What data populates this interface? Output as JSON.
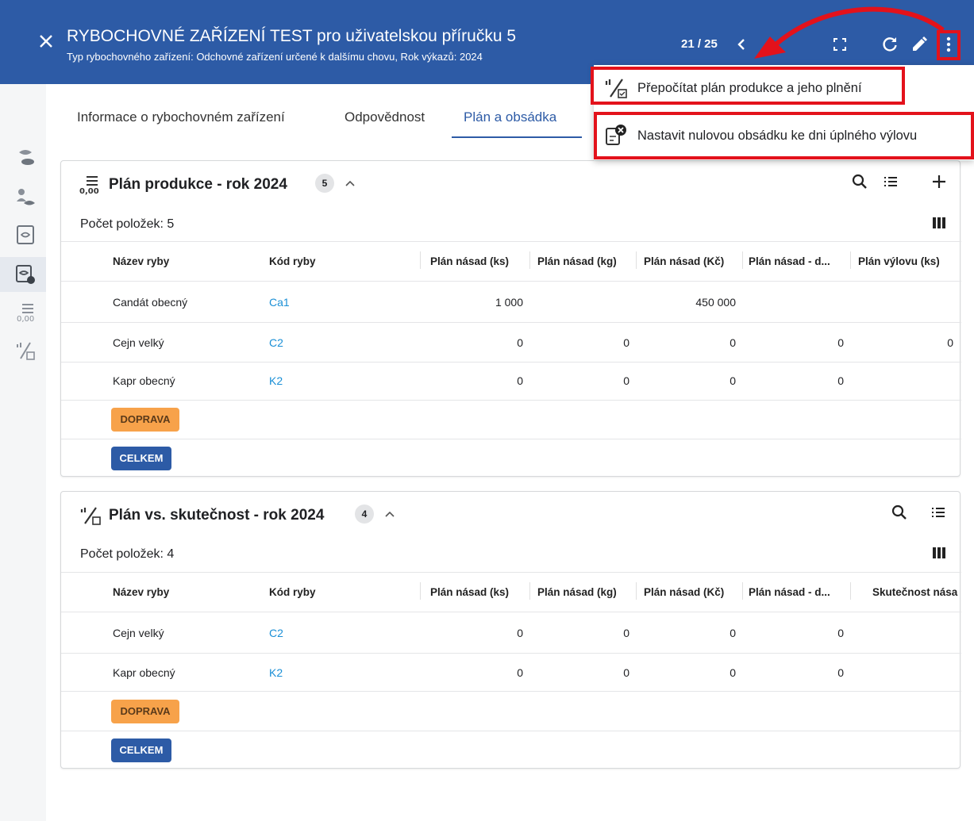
{
  "header": {
    "title": "RYBOCHOVNÉ ZAŘÍZENÍ TEST pro uživatelskou příručku 5",
    "subtitle": "Typ rybochovného zařízení: Odchovné zařízení určené k dalšímu chovu, Rok výkazů: 2024",
    "pager": "21 / 25",
    "icons": [
      "close-icon",
      "chevron-left-icon",
      "fullscreen-icon",
      "refresh-icon",
      "edit-icon",
      "more-vert-icon"
    ],
    "color": "#2d5ba6"
  },
  "menu": {
    "items": [
      {
        "label": "Přepočítat plán produkce a jeho plnění",
        "icon": "recalculate-icon"
      },
      {
        "label": "Nastavit nulovou obsádku ke dni úplného výlovu",
        "icon": "clear-stock-icon"
      }
    ],
    "highlight_color": "#e3121b"
  },
  "tabs": [
    {
      "label": "Informace o rybochovném zařízení",
      "active": false
    },
    {
      "label": "Odpovědnost",
      "active": false
    },
    {
      "label": "Plán a obsádka",
      "active": true
    }
  ],
  "panels": [
    {
      "title": "Plán produkce - rok 2024",
      "badge": "5",
      "count_label": "Počet položek: 5",
      "columns": [
        "Název ryby",
        "Kód ryby",
        "Plán násad (ks)",
        "Plán násad (kg)",
        "Plán násad (Kč)",
        "Plán násad - d...",
        "Plán výlovu (ks)"
      ],
      "rows": [
        [
          "Candát obecný",
          "Ca1",
          "1 000",
          "",
          "450 000",
          "",
          ""
        ],
        [
          "Cejn velký",
          "C2",
          "0",
          "0",
          "0",
          "0",
          "0"
        ],
        [
          "Kapr obecný",
          "K2",
          "0",
          "0",
          "0",
          "0",
          ""
        ]
      ],
      "doprava": "DOPRAVA",
      "celkem": "CELKEM"
    },
    {
      "title": "Plán vs. skutečnost - rok 2024",
      "badge": "4",
      "count_label": "Počet položek: 4",
      "columns": [
        "Název ryby",
        "Kód ryby",
        "Plán násad (ks)",
        "Plán násad (kg)",
        "Plán násad (Kč)",
        "Plán násad - d...",
        "Skutečnost nása"
      ],
      "rows": [
        [
          "Cejn velký",
          "C2",
          "0",
          "0",
          "0",
          "0",
          ""
        ],
        [
          "Kapr obecný",
          "K2",
          "0",
          "0",
          "0",
          "0",
          ""
        ]
      ],
      "doprava": "DOPRAVA",
      "celkem": "CELKEM"
    }
  ]
}
